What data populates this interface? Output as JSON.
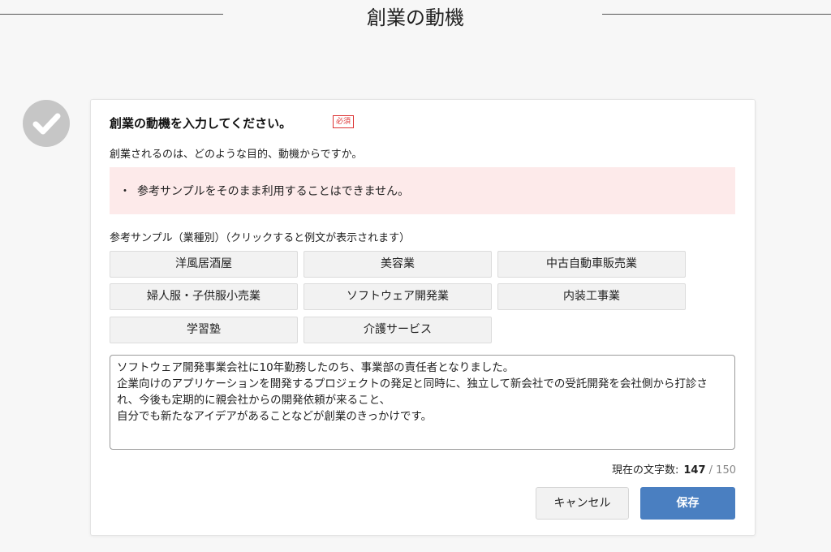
{
  "page": {
    "title": "創業の動機"
  },
  "form": {
    "question": "創業の動機を入力してください。",
    "required_badge": "必須",
    "subtext": "創業されるのは、どのような目的、動機からですか。",
    "notice_bullet": "・",
    "notice_text": "参考サンプルをそのまま利用することはできません。",
    "samples_label": "参考サンプル（業種別）（クリックすると例文が表示されます）",
    "samples": [
      "洋風居酒屋",
      "美容業",
      "中古自動車販売業",
      "婦人服・子供服小売業",
      "ソフトウェア開発業",
      "内装工事業",
      "学習塾",
      "介護サービス"
    ],
    "motive_text": "ソフトウェア開発事業会社に10年勤務したのち、事業部の責任者となりました。\n企業向けのアプリケーションを開発するプロジェクトの発足と同時に、独立して新会社での受託開発を会社側から打診され、今後も定期的に親会社からの開発依頼が来ること、\n自分でも新たなアイデアがあることなどが創業のきっかけです。",
    "char_count_label": "現在の文字数:",
    "char_count": "147",
    "char_max": " / 150",
    "cancel_label": "キャンセル",
    "save_label": "保存"
  },
  "colors": {
    "accent": "#4a7fc1",
    "notice_bg": "#fdeaea",
    "required": "#dd3333",
    "check": "#c6c6c6"
  },
  "icons": {
    "status": "check-circle-icon"
  }
}
